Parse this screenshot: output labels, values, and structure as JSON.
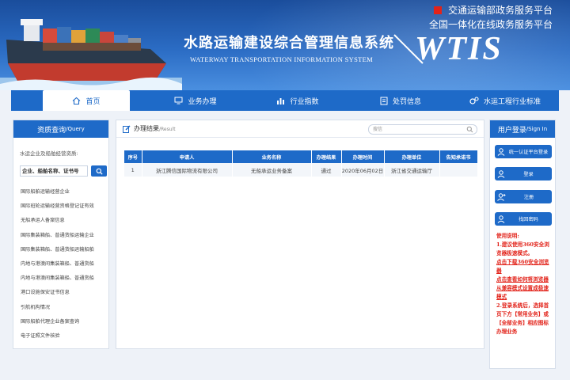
{
  "header": {
    "title_cn": "水路运输建设综合管理信息系统",
    "title_en": "WATERWAY TRANSPORTATION INFORMATION SYSTEM",
    "logo_text": "WTIS",
    "top_links": [
      "交通运输部政务服务平台",
      "全国一体化在线政务服务平台"
    ],
    "accent_red": "#e2231a",
    "brand_blue": "#1e6ac8"
  },
  "nav": {
    "items": [
      {
        "label": "首页",
        "icon": "home-icon"
      },
      {
        "label": "业务办理",
        "icon": "monitor-icon"
      },
      {
        "label": "行业指数",
        "icon": "bar-chart-icon"
      },
      {
        "label": "处罚信息",
        "icon": "document-icon"
      },
      {
        "label": "水运工程行业标准",
        "icon": "gears-icon"
      }
    ]
  },
  "left": {
    "title": "资质查询",
    "title_en": "/Query",
    "intro": "水运企业及船舶经营资质:",
    "search_value": "企业、船舶名称、证书号",
    "list": [
      "国际船舶运输经营企业",
      "国际班轮运输经营资格登记证有效",
      "无船承运人备案信息",
      "国际集装箱船、普通货船运输企业",
      "国际集装箱船、普通货船运输船舶",
      "内地与港澳间集装箱船、普通货船",
      "内地与港澳间集装箱船、普通货船",
      "港口设施保安证书信息",
      "引航机构情况",
      "国际船舶代理企业备案查询",
      "电子证照文件核验"
    ]
  },
  "center": {
    "title": "办理结果",
    "title_en": "/Result",
    "search_placeholder": "搜信",
    "columns": [
      "序号",
      "申请人",
      "业务名称",
      "办理结果",
      "办理时间",
      "办理单位",
      "告知承诺书"
    ],
    "rows": [
      [
        "1",
        "浙江腾信国际物流有限公司",
        "无船承运业务备案",
        "通过",
        "2020年06月02日",
        "浙江省交通运输厅",
        ""
      ]
    ]
  },
  "right": {
    "title": "用户登录",
    "title_en": "/Sign In",
    "buttons": [
      "统一认证平台登录",
      "登录",
      "注册",
      "找回密码"
    ],
    "notes": {
      "heading": "使用说明:",
      "n1": "1.建议使用360安全浏览器极速模式。",
      "link1": "点击下载360安全浏览器",
      "link2": "点击查看如何将浏览器从兼容模式设置成极速模式",
      "n2": "2.登录系统后，选择首页下方【常用业务】或【全部业务】相应图标办理业务"
    }
  }
}
